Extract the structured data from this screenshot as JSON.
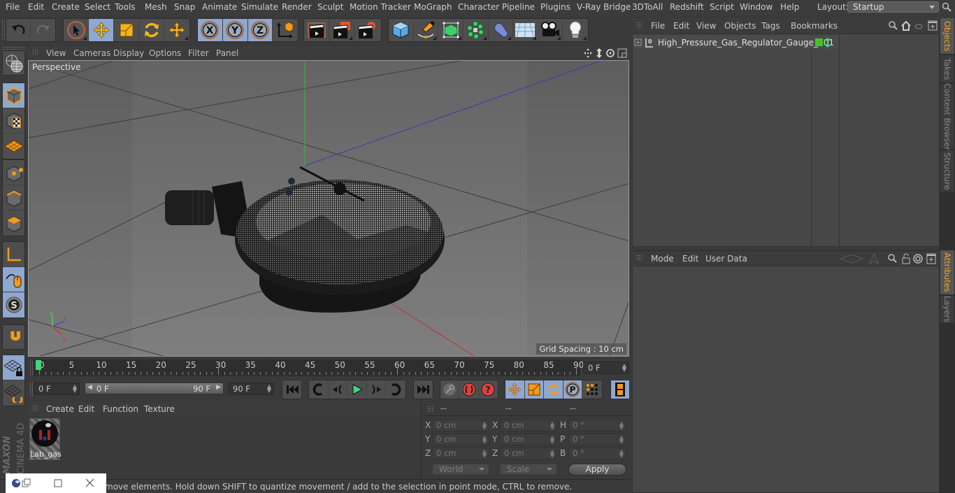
{
  "menubar": {
    "items": [
      "File",
      "Edit",
      "Create",
      "Select",
      "Tools",
      "Mesh",
      "Snap",
      "Animate",
      "Simulate",
      "Render",
      "Sculpt",
      "Motion Tracker",
      "MoGraph",
      "Character",
      "Pipeline",
      "Plugins",
      "V-Ray Bridge",
      "3DToAll",
      "Redshift",
      "Script",
      "Window",
      "Help"
    ],
    "layout_label": "Layout:",
    "layout_value": "Startup"
  },
  "toolbar": {
    "undo": "undo-icon",
    "redo": "redo-icon",
    "tools": [
      "live-selection",
      "move",
      "scale",
      "rotate",
      "last-tool"
    ],
    "axes": [
      "X",
      "Y",
      "Z",
      "coordinate-system"
    ],
    "render": [
      "render-view",
      "render-picture-viewer",
      "render-settings"
    ],
    "objects": [
      "cube",
      "pen",
      "subdivision",
      "cloner",
      "deformer",
      "floor",
      "camera",
      "light"
    ]
  },
  "viewport": {
    "menu": [
      "View",
      "Cameras",
      "Display",
      "Options",
      "Filter",
      "Panel"
    ],
    "camera_label": "Perspective",
    "grid_spacing": "Grid Spacing : 10 cm",
    "axis_labels": {
      "x": "X",
      "y": "Y",
      "z": "Z"
    }
  },
  "timeline": {
    "ticks": [
      "0",
      "5",
      "10",
      "15",
      "20",
      "25",
      "30",
      "35",
      "40",
      "45",
      "50",
      "55",
      "60",
      "65",
      "70",
      "75",
      "80",
      "85",
      "90"
    ],
    "current_frame": "0 F",
    "start_field": "0 F",
    "range_start": "0 F",
    "range_end": "90 F",
    "end_field": "90 F",
    "playhead_color": "#3fd77a"
  },
  "materials": {
    "menu": [
      "Create",
      "Edit",
      "Function",
      "Texture"
    ],
    "items": [
      {
        "name": "Lab_gas"
      }
    ]
  },
  "coordinates": {
    "headers": [
      "--",
      "--",
      "--"
    ],
    "rows": [
      {
        "l1": "X",
        "v1": "0 cm",
        "l2": "X",
        "v2": "0 cm",
        "l3": "H",
        "v3": "0 °"
      },
      {
        "l1": "Y",
        "v1": "0 cm",
        "l2": "Y",
        "v2": "0 cm",
        "l3": "P",
        "v3": "0 °"
      },
      {
        "l1": "Z",
        "v1": "0 cm",
        "l2": "Z",
        "v2": "0 cm",
        "l3": "B",
        "v3": "0 °"
      }
    ],
    "mode_dropdown": "World",
    "scale_dropdown": "Scale",
    "apply": "Apply"
  },
  "status": {
    "text": "move elements. Hold down SHIFT to quantize movement / add to the selection in point mode, CTRL to remove."
  },
  "objects_panel": {
    "menu": [
      "File",
      "Edit",
      "View",
      "Objects",
      "Tags",
      "Bookmarks"
    ],
    "rows": [
      {
        "name": "High_Pressure_Gas_Regulator_Gauge_001",
        "layer_color": "#44c425"
      }
    ]
  },
  "attributes_panel": {
    "menu": [
      "Mode",
      "Edit",
      "User Data"
    ]
  },
  "side_tabs": {
    "top": [
      "Objects",
      "Takes",
      "Content Browser",
      "Structure"
    ],
    "bottom": [
      "Attributes",
      "Layers"
    ],
    "active_color": "#f0a830"
  },
  "branding": {
    "maxon": "MAXON",
    "product": "CINEMA 4D"
  }
}
